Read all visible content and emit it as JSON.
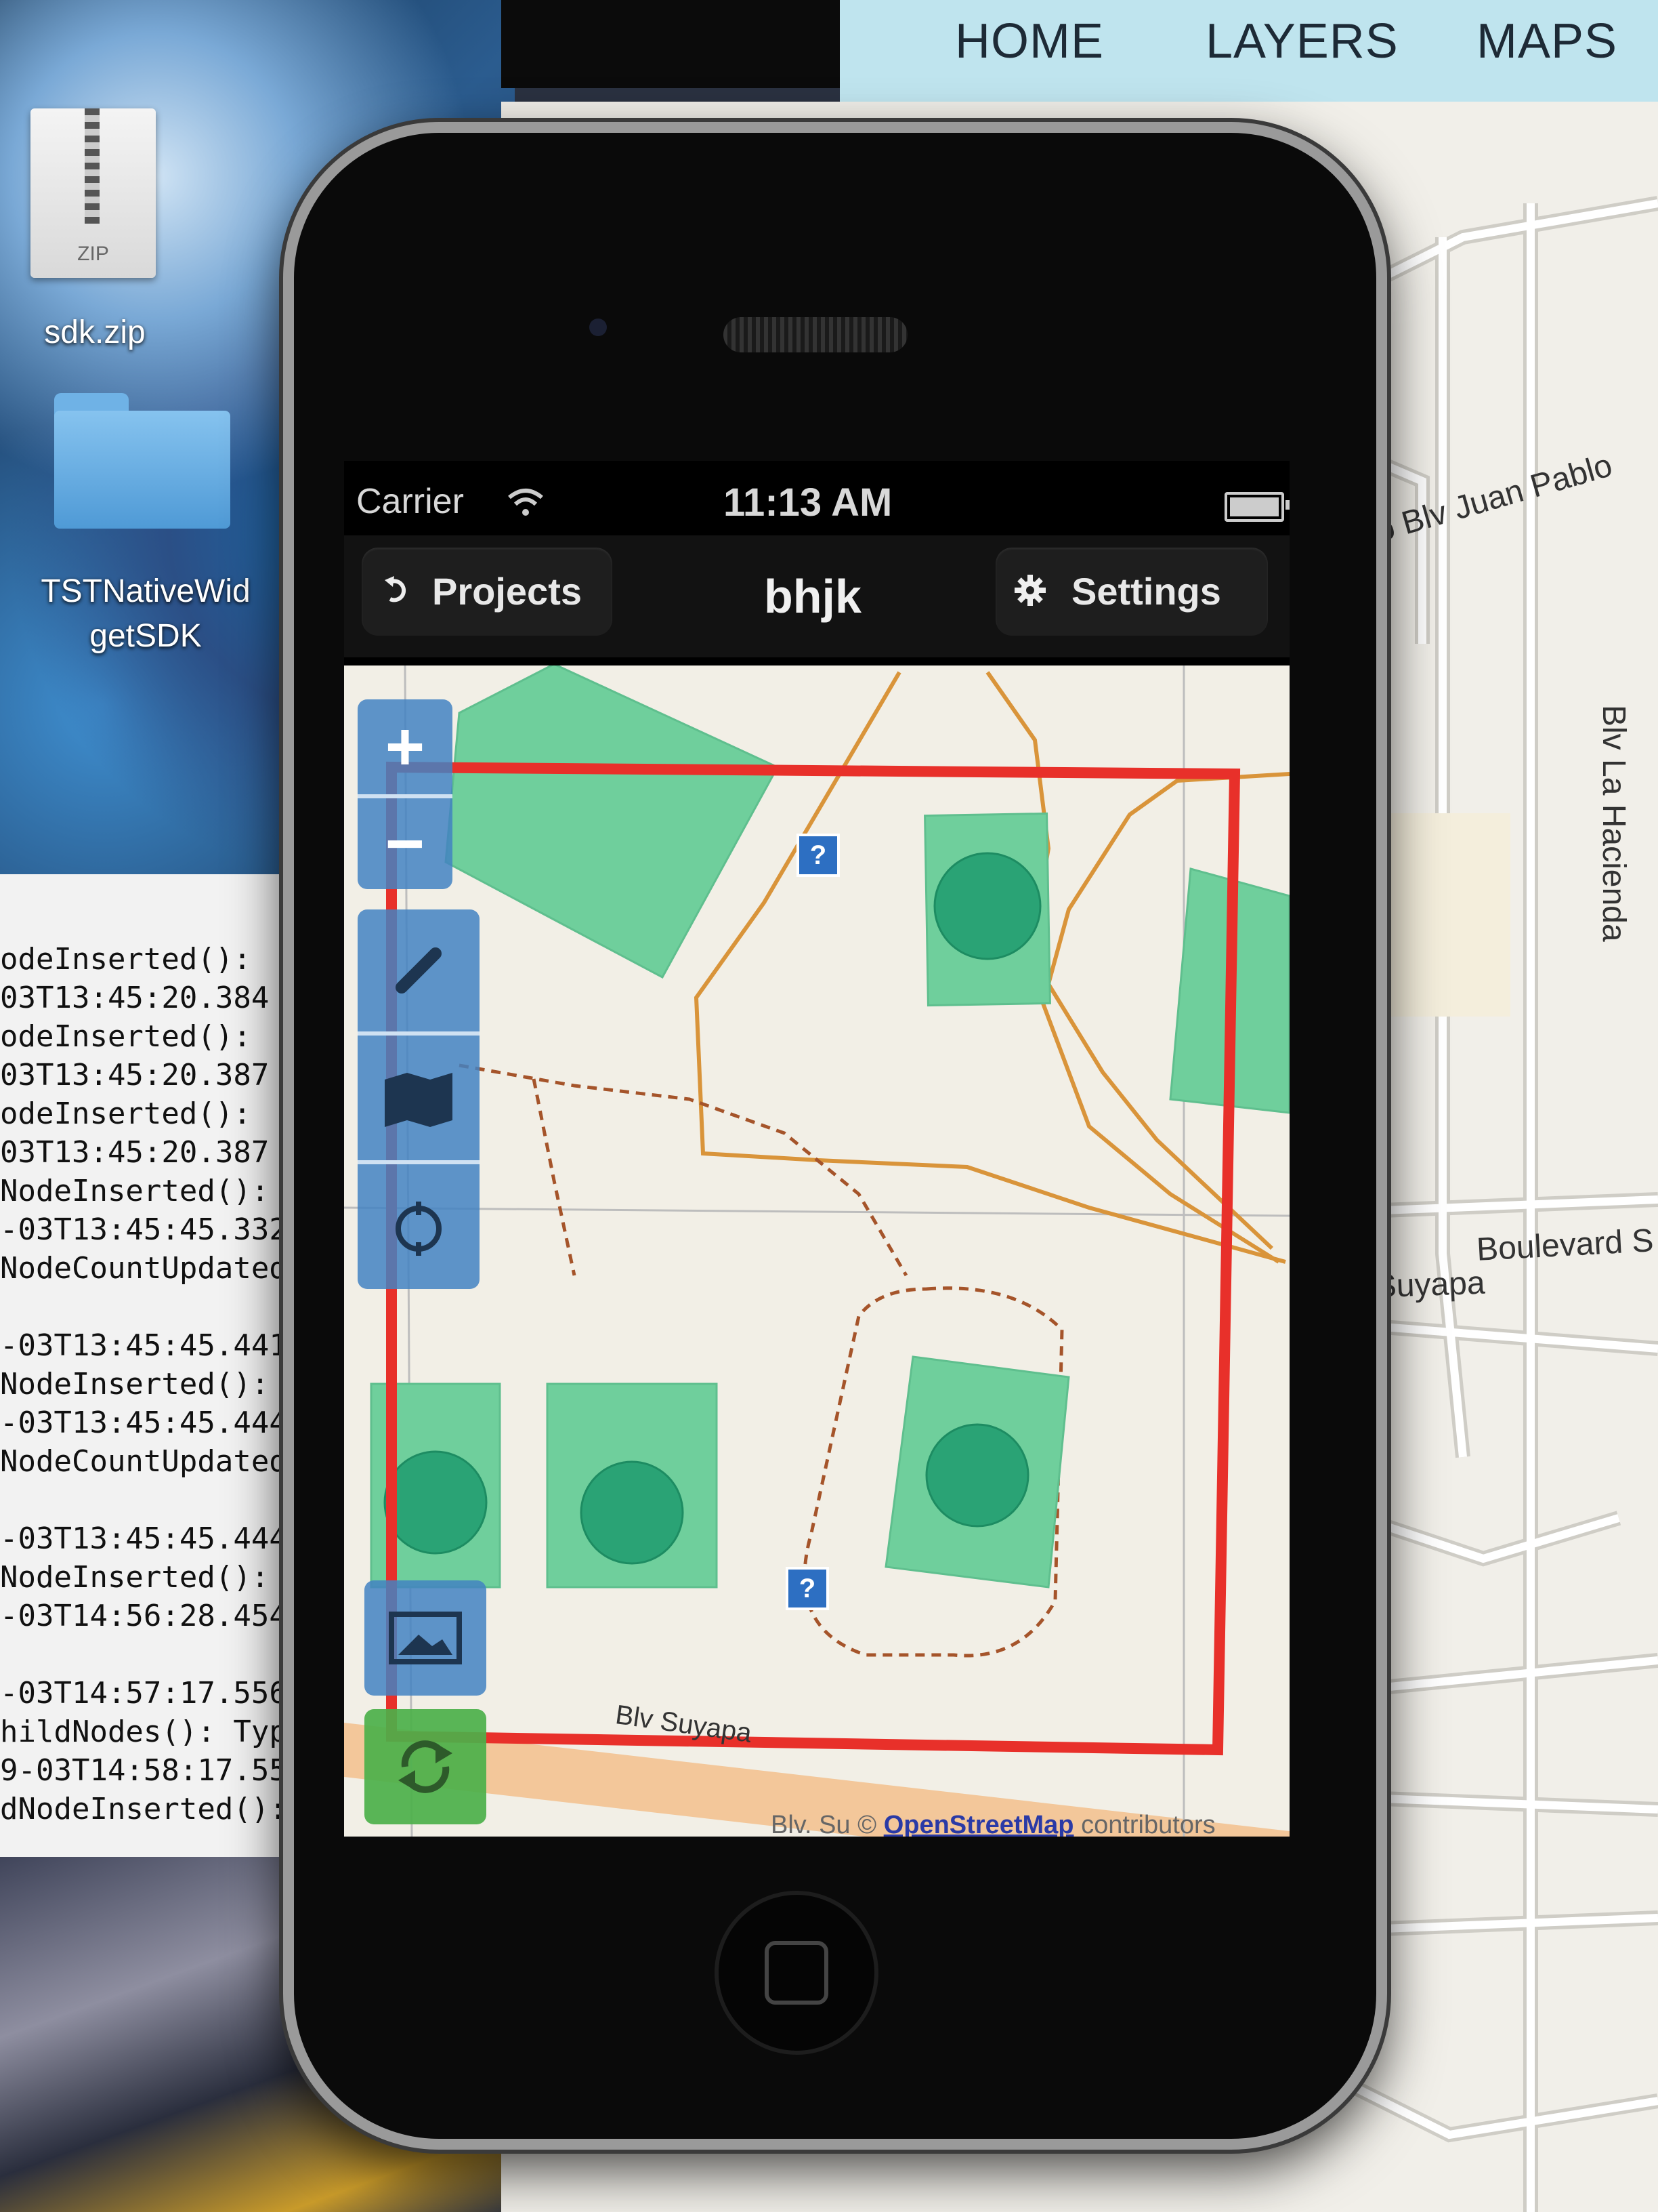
{
  "desktop": {
    "zip_icon_text": "ZIP",
    "zip_label": "sdk.zip",
    "folder_label_line1": "TSTNativeWid",
    "folder_label_line2": "getSDK"
  },
  "console": {
    "lines": [
      "odeInserted():",
      "03T13:45:20.384",
      "odeInserted():",
      "03T13:45:20.387",
      "odeInserted():",
      "03T13:45:20.387",
      "NodeInserted():",
      "-03T13:45:45.332",
      "NodeCountUpdated",
      "",
      "-03T13:45:45.441",
      "NodeInserted():",
      "-03T13:45:45.444",
      "NodeCountUpdated",
      "",
      "-03T13:45:45.444",
      "NodeInserted():",
      "-03T14:56:28.454",
      "",
      "-03T14:57:17.556",
      "hildNodes(): Type",
      "9-03T14:58:17.557",
      "dNodeInserted():"
    ]
  },
  "web_page": {
    "nav": [
      "HOME",
      "LAYERS",
      "MAPS"
    ],
    "roads": {
      "juan_pablo": "ro Blv Juan Pablo",
      "la_hacienda": "Blv La Hacienda",
      "boulevard": "Boulevard S",
      "suyapa": "Blv. Suyapa"
    }
  },
  "phone": {
    "status": {
      "carrier": "Carrier",
      "time": "11:13 AM"
    },
    "navbar": {
      "back_label": "Projects",
      "title": "bhjk",
      "settings_label": "Settings"
    },
    "map": {
      "road_label_1": "Blv Suyapa",
      "road_label_2": "Blv. Su",
      "attribution_prefix": "©",
      "attribution_link": "OpenStreetMap",
      "attribution_suffix": "contributors",
      "help_marker": "?"
    },
    "controls": [
      "zoom-in",
      "zoom-out",
      "draw",
      "layers-map",
      "locate",
      "image",
      "sync"
    ]
  },
  "colors": {
    "feature_fill": "#6fcf9c",
    "feature_circle": "#2aa375",
    "bbox_red": "#e8302a",
    "path_orange": "#d9943a",
    "control_blue": "#4382c2",
    "sync_green": "#4cb04a"
  }
}
